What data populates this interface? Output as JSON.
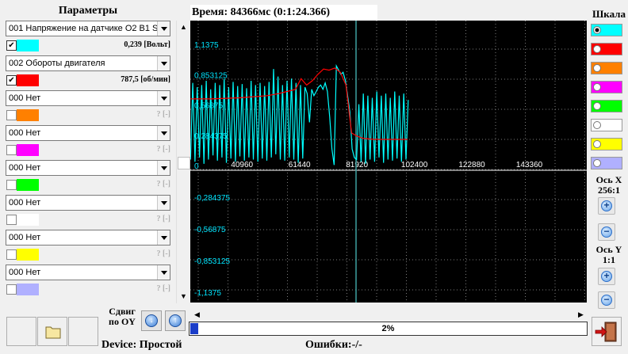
{
  "params_panel": {
    "title": "Параметры",
    "channels": [
      {
        "sensor": "001 Напряжение на датчике O2 B1 S",
        "checked": true,
        "color": "#00ffff",
        "value": "0,239 [Вольт]",
        "active": true
      },
      {
        "sensor": "002 Обороты двигателя",
        "checked": true,
        "color": "#ff0000",
        "value": "787,5 [об/мин]",
        "active": true
      },
      {
        "sensor": "000 Нет",
        "checked": false,
        "color": "#ff8000",
        "value": "? [-]",
        "active": false
      },
      {
        "sensor": "000 Нет",
        "checked": false,
        "color": "#ff00ff",
        "value": "? [-]",
        "active": false
      },
      {
        "sensor": "000 Нет",
        "checked": false,
        "color": "#00ff00",
        "value": "? [-]",
        "active": false
      },
      {
        "sensor": "000 Нет",
        "checked": false,
        "color": "#ffffff",
        "value": "? [-]",
        "active": false
      },
      {
        "sensor": "000 Нет",
        "checked": false,
        "color": "#ffff00",
        "value": "? [-]",
        "active": false
      },
      {
        "sensor": "000 Нет",
        "checked": false,
        "color": "#b0b0ff",
        "value": "? [-]",
        "active": false
      }
    ]
  },
  "header": {
    "time_label": "Время: 84366мс (0:1:24.366)"
  },
  "chart_data": {
    "type": "line",
    "x_ticks": [
      "40960",
      "61440",
      "81920",
      "102400",
      "122880",
      "143360"
    ],
    "y_ticks": [
      "1,1375",
      "0,853125",
      "0,56875",
      "0,284375",
      "0",
      "-0,284375",
      "-0,56875",
      "-0,853125",
      "-1,1375"
    ],
    "ylim": [
      -1.1375,
      1.1375
    ],
    "xlim": [
      22528,
      163840
    ],
    "cursor_x": 81600,
    "grid": true,
    "series": [
      {
        "color": "#00ffff",
        "x": [
          22600,
          23400,
          24200,
          25000,
          25800,
          26600,
          27400,
          28200,
          29000,
          29800,
          30600,
          31400,
          32200,
          33000,
          33800,
          34600,
          35400,
          36200,
          37000,
          37800,
          38600,
          39400,
          40200,
          41000,
          41800,
          42600,
          43400,
          44200,
          45000,
          45800,
          46600,
          47400,
          48200,
          49000,
          49800,
          50600,
          51400,
          52200,
          53000,
          53800,
          54600,
          55400,
          56200,
          57000,
          57800,
          58600,
          59400,
          60200,
          61000,
          61800,
          62600,
          63400,
          64200,
          65000,
          65800,
          66600,
          67400,
          68200,
          69000,
          69800,
          70600,
          71400,
          72200,
          73000,
          73800,
          74600,
          75400,
          76200,
          77000,
          77800,
          78600,
          79400,
          80200,
          81000,
          81800,
          82600,
          83400,
          84200,
          85000,
          85800,
          86600,
          87400,
          88200,
          89000,
          89800,
          90600,
          91400,
          92200,
          93000,
          93800,
          94600,
          95400,
          96200,
          97000,
          97800,
          98600,
          99400,
          100200
        ],
        "y": [
          0.1,
          0.82,
          0.08,
          0.78,
          0.12,
          0.8,
          0.06,
          0.84,
          0.1,
          0.76,
          0.14,
          0.82,
          0.09,
          0.8,
          0.12,
          0.86,
          0.07,
          0.78,
          0.11,
          0.83,
          0.08,
          0.79,
          0.13,
          0.81,
          0.09,
          0.77,
          0.12,
          0.84,
          0.1,
          0.8,
          0.08,
          0.82,
          0.11,
          0.79,
          0.09,
          0.83,
          0.12,
          0.95,
          0.15,
          0.88,
          0.1,
          0.8,
          0.09,
          0.84,
          0.12,
          0.86,
          0.1,
          0.82,
          0.07,
          0.8,
          0.11,
          0.78,
          0.72,
          0.45,
          0.76,
          0.7,
          0.74,
          0.78,
          0.8,
          0.76,
          0.82,
          0.74,
          0.5,
          0.2,
          0.05,
          0.98,
          0.94,
          0.9,
          0.92,
          0.84,
          0.7,
          0.55,
          0.2,
          0.12,
          0.1,
          0.62,
          0.08,
          0.72,
          0.06,
          0.7,
          0.1,
          0.68,
          0.08,
          0.74,
          0.12,
          0.7,
          0.07,
          0.72,
          0.1,
          0.68,
          0.09,
          0.74,
          0.11,
          0.7,
          0.08,
          0.72,
          0.1,
          0.66
        ]
      },
      {
        "color": "#ff0000",
        "x": [
          22600,
          30000,
          40000,
          50000,
          54000,
          57000,
          60000,
          62000,
          64000,
          66000,
          68000,
          70000,
          72000,
          74000,
          76000,
          78000,
          80000,
          82000,
          84000,
          88000,
          92000,
          96000,
          100000
        ],
        "y": [
          0.67,
          0.67,
          0.68,
          0.7,
          0.72,
          0.74,
          0.76,
          0.86,
          0.8,
          0.84,
          0.9,
          0.95,
          0.94,
          0.96,
          0.92,
          0.8,
          0.35,
          0.32,
          0.3,
          0.29,
          0.29,
          0.29,
          0.29
        ]
      }
    ]
  },
  "scale_panel": {
    "title": "Шкала",
    "colors": [
      "#00ffff",
      "#ff0000",
      "#ff8000",
      "#ff00ff",
      "#00ff00",
      "#ffffff",
      "#ffff00",
      "#b0b0ff"
    ],
    "selected_index": 0
  },
  "axis_x": {
    "label": "Ось X",
    "value": "256:1"
  },
  "axis_y": {
    "label": "Ось Y",
    "value": "1:1"
  },
  "shift": {
    "label": "Сдвиг по OY"
  },
  "progress": {
    "value": 0.02,
    "text": "2%"
  },
  "status": {
    "device": "Device: Простой",
    "errors": "Ошибки:-/-"
  }
}
